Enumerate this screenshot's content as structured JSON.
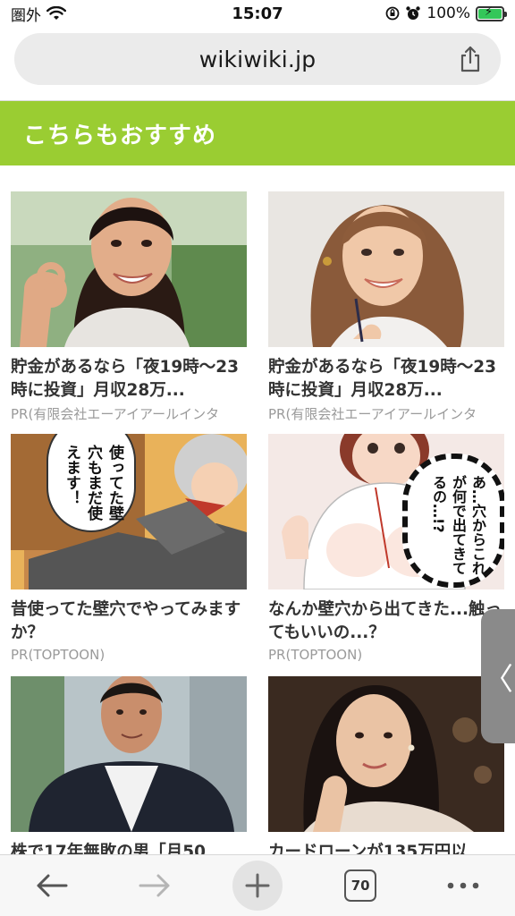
{
  "status": {
    "carrier": "圏外",
    "time": "15:07",
    "battery": "100%",
    "battery_level": 1.0
  },
  "address_bar": {
    "url": "wikiwiki.jp"
  },
  "recommendations": {
    "heading": "こちらもおすすめ",
    "accent_color": "#9acd32",
    "cards": [
      {
        "title": "貯金があるなら「夜19時〜23時に投資」月収28万...",
        "source": "PR(有限会社エーアイアールインタ"
      },
      {
        "title": "貯金があるなら「夜19時〜23時に投資」月収28万...",
        "source": "PR(有限会社エーアイアールインタ"
      },
      {
        "title": "昔使ってた壁穴でやってみますか？",
        "source": "PR(TOPTOON)",
        "speech": "使ってた壁穴もまだ使えます！"
      },
      {
        "title": "なんか壁穴から出てきた...触ってもいいの...？",
        "source": "PR(TOPTOON)",
        "speech": "あ…穴からこれが何で出てきてるの…!?"
      },
      {
        "title": "株で17年無敗の男「月50",
        "source": ""
      },
      {
        "title": "カードローンが135万円以",
        "source": ""
      }
    ]
  },
  "side_tab": {
    "icon": "chevron-left-icon",
    "glyph": "〈"
  },
  "toolbar": {
    "back": "back-arrow-icon",
    "forward": "forward-arrow-icon",
    "new_tab": "plus-icon",
    "tab_count": "70",
    "more": "more-icon"
  }
}
